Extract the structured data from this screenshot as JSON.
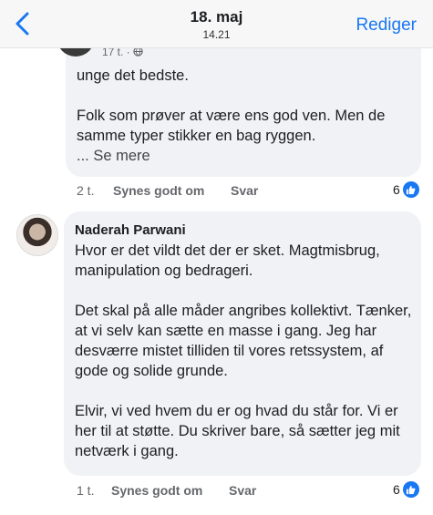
{
  "header": {
    "title": "18. maj",
    "subtitle": "14.21",
    "edit_label": "Rediger"
  },
  "previous_comment": {
    "meta": "17 t. · ",
    "paragraphs": [
      "unge det bedste.",
      "Folk som prøver at være ens god ven. Men de samme typer stikker en bag ryggen."
    ],
    "see_more": "... Se mere",
    "time": "2 t.",
    "like_label": "Synes godt om",
    "reply_label": "Svar",
    "like_count": "6"
  },
  "comment": {
    "author": "Naderah Parwani",
    "paragraphs": [
      "Hvor er det vildt det der er sket. Magtmisbrug, manipulation og bedrageri.",
      "Det skal på alle måder angribes kollektivt. Tænker, at vi selv kan sætte en masse i gang. Jeg har desværre mistet tilliden til vores retssystem, af gode og solide grunde.",
      "Elvir, vi ved hvem du er og hvad du står for. Vi er her til at støtte. Du skriver bare, så sætter jeg mit netværk i gang."
    ],
    "time": "1 t.",
    "like_label": "Synes godt om",
    "reply_label": "Svar",
    "like_count": "6"
  },
  "colors": {
    "accent": "#1877f2",
    "bubble": "#f0f2f5",
    "muted": "#65676b"
  },
  "icons": [
    "back-chevron-icon",
    "globe-icon",
    "thumbs-up-icon"
  ]
}
